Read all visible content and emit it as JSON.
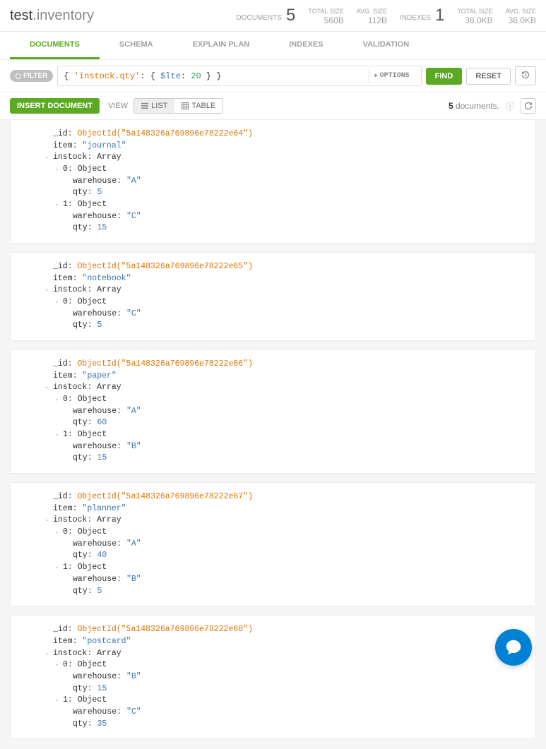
{
  "namespace": {
    "db": "test",
    "coll": "inventory"
  },
  "header_stats": {
    "documents_label": "DOCUMENTS",
    "documents_count": "5",
    "doc_total_size_label": "TOTAL SIZE",
    "doc_total_size": "560B",
    "doc_avg_size_label": "AVG. SIZE",
    "doc_avg_size": "112B",
    "indexes_label": "INDEXES",
    "indexes_count": "1",
    "idx_total_size_label": "TOTAL SIZE",
    "idx_total_size": "36.0KB",
    "idx_avg_size_label": "AVG. SIZE",
    "idx_avg_size": "36.0KB"
  },
  "tabs": {
    "documents": "Documents",
    "schema": "Schema",
    "explain": "Explain Plan",
    "indexes": "Indexes",
    "validation": "Validation"
  },
  "filter": {
    "pill": "FILTER",
    "query_open": "{ ",
    "query_key": "'instock.qty'",
    "query_mid1": ": { ",
    "query_op": "$lte",
    "query_mid2": ": ",
    "query_val": "20",
    "query_close": " } }",
    "options": "OPTIONS",
    "find": "FIND",
    "reset": "RESET"
  },
  "toolbar": {
    "insert": "INSERT DOCUMENT",
    "view": "VIEW",
    "list": "LIST",
    "table": "TABLE",
    "count_num": "5",
    "count_text": " documents."
  },
  "docs": [
    {
      "_id": "ObjectId(\"5a148326a769896e78222e64\")",
      "item": "\"journal\"",
      "instock": [
        {
          "warehouse": "\"A\"",
          "qty": "5"
        },
        {
          "warehouse": "\"C\"",
          "qty": "15"
        }
      ]
    },
    {
      "_id": "ObjectId(\"5a148326a769896e78222e65\")",
      "item": "\"notebook\"",
      "instock": [
        {
          "warehouse": "\"C\"",
          "qty": "5"
        }
      ]
    },
    {
      "_id": "ObjectId(\"5a148326a769896e78222e66\")",
      "item": "\"paper\"",
      "instock": [
        {
          "warehouse": "\"A\"",
          "qty": "60"
        },
        {
          "warehouse": "\"B\"",
          "qty": "15"
        }
      ]
    },
    {
      "_id": "ObjectId(\"5a148326a769896e78222e67\")",
      "item": "\"planner\"",
      "instock": [
        {
          "warehouse": "\"A\"",
          "qty": "40"
        },
        {
          "warehouse": "\"B\"",
          "qty": "5"
        }
      ]
    },
    {
      "_id": "ObjectId(\"5a148326a769896e78222e68\")",
      "item": "\"postcard\"",
      "instock": [
        {
          "warehouse": "\"B\"",
          "qty": "15"
        },
        {
          "warehouse": "\"C\"",
          "qty": "35"
        }
      ]
    }
  ]
}
